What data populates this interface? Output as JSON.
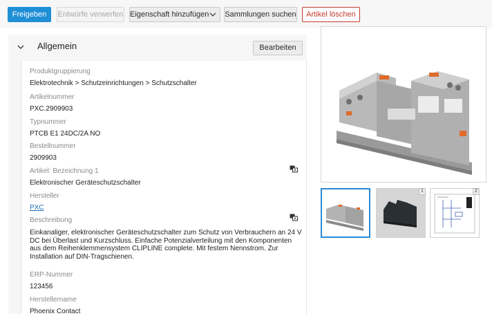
{
  "toolbar": {
    "release_label": "Freigeben",
    "discard_label": "Entwürfe verwerfen",
    "add_property_label": "Eigenschaft hinzufügen",
    "search_collections_label": "Sammlungen suchen",
    "delete_article_label": "Artikel löschen"
  },
  "panel": {
    "title": "Allgemein",
    "edit_label": "Bearbeiten"
  },
  "fields": [
    {
      "label": "Produktgruppierung",
      "value": "Elektrotechnik > Schutzeinrichtungen > Schutzschalter"
    },
    {
      "label": "Artikelnummer",
      "value": "PXC.2909903"
    },
    {
      "label": "Typnummer",
      "value": "PTCB E1 24DC/2A NO"
    },
    {
      "label": "Bestellnummer",
      "value": "2909903"
    },
    {
      "label": "Artikel: Bezeichnung 1",
      "value": "Elektronischer Geräteschutzschalter"
    },
    {
      "label": "Hersteller",
      "value": "PXC"
    },
    {
      "label": "Beschreibung",
      "value": "Einkanaliger, elektronischer Geräteschutzschalter zum Schutz von Verbrauchern an 24 V DC bei Überlast und Kurzschluss. Einfache Potenzialverteilung mit den Komponenten aus dem Reihenklemmensystem CLIPLINE complete. Mit festem Nennstrom. Zur Installation auf DIN-Tragschienen."
    },
    {
      "label": "ERP-Nummer",
      "value": "123456"
    },
    {
      "label": "Herstellername",
      "value": "Phoenix Contact"
    }
  ],
  "icons": {
    "translate": "translate-icon",
    "collapse": "chevron-down-icon"
  },
  "gallery": {
    "thumbnail_badges": [
      "1",
      "2"
    ]
  },
  "colors": {
    "primary": "#1f8fd6",
    "danger": "#c0392b",
    "link": "#1f6fb8"
  }
}
